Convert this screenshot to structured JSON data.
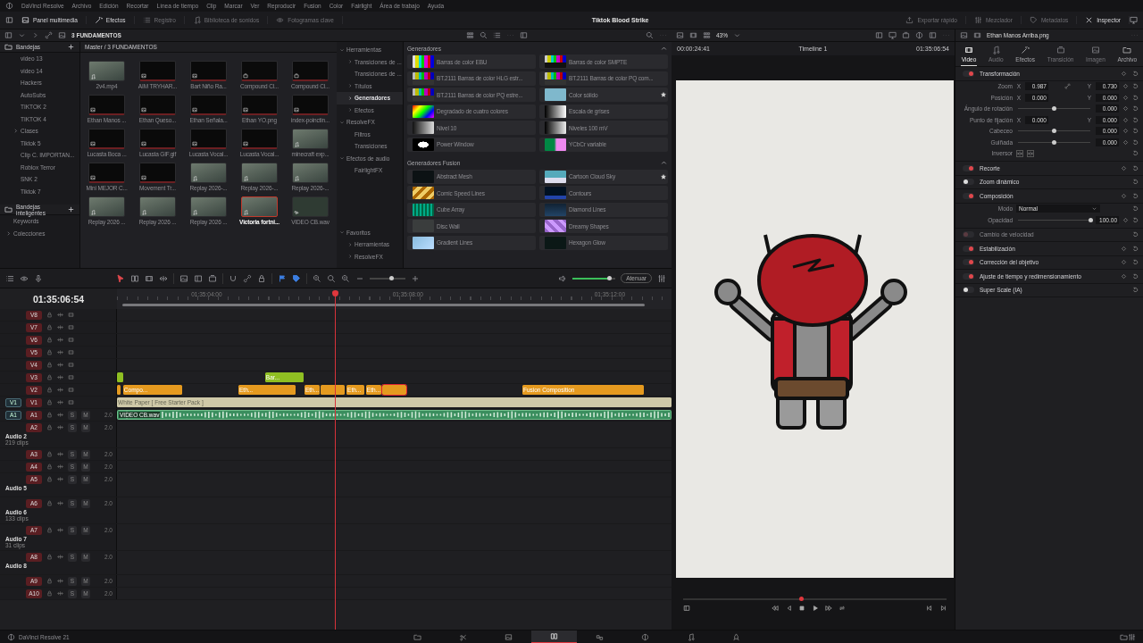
{
  "menu_bar": {
    "app": "DaVinci Resolve",
    "items": [
      "Archivo",
      "Edición",
      "Recortar",
      "Línea de tiempo",
      "Clip",
      "Marcar",
      "Ver",
      "Reproducir",
      "Fusion",
      "Color",
      "Fairlight",
      "Área de trabajo",
      "Ayuda"
    ]
  },
  "toolbar": {
    "left": [
      {
        "label": "Panel multimedia",
        "on": true
      },
      {
        "label": "Efectos",
        "on": true
      },
      {
        "label": "Registro",
        "on": false
      },
      {
        "label": "Biblioteca de sonidos",
        "on": false
      },
      {
        "label": "Fotogramas clave",
        "on": false
      }
    ],
    "project_title": "Tiktok Blood Strike",
    "right": [
      {
        "label": "Exportar rápido",
        "on": false
      },
      {
        "label": "Mezclador",
        "on": false
      },
      {
        "label": "Metadatos",
        "on": false
      },
      {
        "label": "Inspector",
        "on": true
      }
    ]
  },
  "media_pool": {
    "bin_name": "3 FUNDAMENTOS",
    "bins_title": "Bandejas",
    "bins": [
      {
        "label": "video 13",
        "expandable": false
      },
      {
        "label": "video 14",
        "expandable": false
      },
      {
        "label": "Hackers",
        "expandable": false
      },
      {
        "label": "AutoSubs",
        "expandable": false
      },
      {
        "label": "TIKTOK 2",
        "expandable": false
      },
      {
        "label": "TIKTOK 4",
        "expandable": false
      },
      {
        "label": "Clases",
        "expandable": true
      },
      {
        "label": "Tiktok 5",
        "expandable": false
      },
      {
        "label": "Clip C. IMPORTAN...",
        "expandable": false
      },
      {
        "label": "Roblox Terror",
        "expandable": false
      },
      {
        "label": "SNK 2",
        "expandable": false
      },
      {
        "label": "Tiktok 7",
        "expandable": false
      }
    ],
    "smart_bins_title": "Bandejas inteligentes",
    "smart_bins": [
      {
        "label": "Keywords",
        "expandable": false
      },
      {
        "label": "Colecciones",
        "expandable": true
      }
    ],
    "path": "Master / 3 FUNDAMENTOS",
    "clips": [
      {
        "name": "2v4.mp4",
        "kind": "video",
        "selected": false
      },
      {
        "name": "AIM TRYHAR...",
        "kind": "image",
        "selected": false
      },
      {
        "name": "Bart Niño Ra...",
        "kind": "image",
        "selected": false
      },
      {
        "name": "Compound Cl...",
        "kind": "compound",
        "selected": false
      },
      {
        "name": "Compound Cl...",
        "kind": "compound",
        "selected": false
      },
      {
        "name": "Ethan Manos ...",
        "kind": "image",
        "selected": false
      },
      {
        "name": "Ethan Queso...",
        "kind": "image",
        "selected": false
      },
      {
        "name": "Ethan Señala...",
        "kind": "image",
        "selected": false
      },
      {
        "name": "Ethan YO.png",
        "kind": "image",
        "selected": false
      },
      {
        "name": "index-poinctin...",
        "kind": "image",
        "selected": false
      },
      {
        "name": "Lucasta Boca ...",
        "kind": "image",
        "selected": false
      },
      {
        "name": "Lucasta GIF.gif",
        "kind": "image",
        "selected": false
      },
      {
        "name": "Lucasta Vocal...",
        "kind": "image",
        "selected": false
      },
      {
        "name": "Lucasta Vocal...",
        "kind": "image",
        "selected": false
      },
      {
        "name": "minecraft exp...",
        "kind": "video",
        "selected": false
      },
      {
        "name": "Mini MEJOR C...",
        "kind": "image",
        "selected": false
      },
      {
        "name": "Movement Tr...",
        "kind": "image",
        "selected": false
      },
      {
        "name": "Replay 2026-...",
        "kind": "video",
        "selected": false
      },
      {
        "name": "Replay 2026-...",
        "kind": "video",
        "selected": false
      },
      {
        "name": "Replay 2026-...",
        "kind": "video",
        "selected": false
      },
      {
        "name": "Replay 2026 ...",
        "kind": "video",
        "selected": false
      },
      {
        "name": "Replay 2026 ...",
        "kind": "video",
        "selected": false
      },
      {
        "name": "Replay 2026 ...",
        "kind": "video",
        "selected": false
      },
      {
        "name": "Victoria fortni...",
        "kind": "video",
        "selected": true
      },
      {
        "name": "VIDEO CB.wav",
        "kind": "audio",
        "selected": false
      }
    ]
  },
  "effects_library": {
    "tree": [
      {
        "label": "Herramientas",
        "expandable": true,
        "expanded": true,
        "selected": false,
        "children": [
          {
            "label": "Transiciones de ...",
            "expandable": true,
            "expanded": false,
            "selected": false
          },
          {
            "label": "Transiciones de ...",
            "expandable": false,
            "expanded": false,
            "selected": false
          },
          {
            "label": "Títulos",
            "expandable": true,
            "expanded": false,
            "selected": false
          },
          {
            "label": "Generadores",
            "expandable": true,
            "expanded": false,
            "selected": true
          },
          {
            "label": "Efectos",
            "expandable": true,
            "expanded": false,
            "selected": false
          }
        ]
      },
      {
        "label": "ResolveFX",
        "expandable": true,
        "expanded": true,
        "selected": false,
        "children": [
          {
            "label": "Filtros",
            "expandable": false,
            "expanded": false,
            "selected": false
          },
          {
            "label": "Transiciones",
            "expandable": false,
            "expanded": false,
            "selected": false
          }
        ]
      },
      {
        "label": "Efectos de audio",
        "expandable": true,
        "expanded": true,
        "selected": false,
        "children": [
          {
            "label": "FairlightFX",
            "expandable": false,
            "expanded": false,
            "selected": false
          }
        ]
      }
    ],
    "favorites": {
      "label": "Favoritos",
      "children": [
        {
          "label": "Herramientas",
          "expandable": true,
          "expanded": false,
          "selected": false
        },
        {
          "label": "ResolveFX",
          "expandable": true,
          "expanded": false,
          "selected": false
        }
      ]
    },
    "sections": [
      {
        "title": "Generadores",
        "items": [
          {
            "name": "Barras de color EBU",
            "favorite": false
          },
          {
            "name": "Barras de color SMPTE",
            "favorite": false
          },
          {
            "name": "BT.2111 Barras de color HLG estr...",
            "favorite": false
          },
          {
            "name": "BT.2111 Barras de color PQ com...",
            "favorite": false
          },
          {
            "name": "BT.2111 Barras de color PQ estre...",
            "favorite": false
          },
          {
            "name": "Color sólido",
            "favorite": true
          },
          {
            "name": "Degradado de cuatro colores",
            "favorite": false
          },
          {
            "name": "Escala de grises",
            "favorite": false
          },
          {
            "name": "Nivel 10",
            "favorite": false
          },
          {
            "name": "Niveles 100 mV",
            "favorite": false
          },
          {
            "name": "Power Window",
            "favorite": false
          },
          {
            "name": "YCbCr variable",
            "favorite": false
          }
        ]
      },
      {
        "title": "Generadores Fusion",
        "items": [
          {
            "name": "Abstract Mesh",
            "favorite": false
          },
          {
            "name": "Cartoon Cloud Sky",
            "favorite": true
          },
          {
            "name": "Comic Speed Lines",
            "favorite": false
          },
          {
            "name": "Contours",
            "favorite": false
          },
          {
            "name": "Cube Array",
            "favorite": false
          },
          {
            "name": "Diamond Lines",
            "favorite": false
          },
          {
            "name": "Disc Wall",
            "favorite": false
          },
          {
            "name": "Dreamy Shapes",
            "favorite": false
          },
          {
            "name": "Gradient Lines",
            "favorite": false
          },
          {
            "name": "Hexagon Glow",
            "favorite": false
          }
        ]
      }
    ]
  },
  "viewer": {
    "zoom": "43%",
    "source_timecode": "00:00:24:41",
    "timeline_name": "Timeline 1",
    "record_timecode": "01:35:06:54"
  },
  "inspector": {
    "clip_name": "Ethan Manos Arriba.png",
    "tabs": [
      {
        "label": "Video",
        "selected": true,
        "disabled": false
      },
      {
        "label": "Audio",
        "selected": false,
        "disabled": true
      },
      {
        "label": "Efectos",
        "selected": false,
        "disabled": false
      },
      {
        "label": "Transición",
        "selected": false,
        "disabled": true
      },
      {
        "label": "Imagen",
        "selected": false,
        "disabled": true
      },
      {
        "label": "Archivo",
        "selected": false,
        "disabled": false
      }
    ],
    "sections": [
      {
        "title": "Transformación",
        "on": true,
        "disabled": false,
        "params": [
          {
            "kind": "xy",
            "label": "Zoom",
            "linked": true,
            "x": {
              "axis": "X",
              "value": "0.987"
            },
            "y": {
              "axis": "Y",
              "value": "0.730"
            }
          },
          {
            "kind": "xy",
            "label": "Posición",
            "linked": false,
            "x": {
              "axis": "X",
              "value": "0.000"
            },
            "y": {
              "axis": "Y",
              "value": "0.000"
            }
          },
          {
            "kind": "slider",
            "label": "Ángulo de rotación",
            "level": 0.5,
            "value": "0.000"
          },
          {
            "kind": "xy",
            "label": "Punto de fijación",
            "linked": false,
            "x": {
              "axis": "X",
              "value": "0.000"
            },
            "y": {
              "axis": "Y",
              "value": "0.000"
            }
          },
          {
            "kind": "slider",
            "label": "Cabeceo",
            "level": 0.5,
            "value": "0.000"
          },
          {
            "kind": "slider",
            "label": "Guiñada",
            "level": 0.5,
            "value": "0.000"
          },
          {
            "kind": "flip",
            "label": "Inversor"
          }
        ]
      },
      {
        "title": "Recorte",
        "on": true,
        "disabled": false
      },
      {
        "title": "Zoom dinámico",
        "on": false,
        "disabled": false
      },
      {
        "title": "Composición",
        "on": true,
        "disabled": false,
        "params": [
          {
            "kind": "select",
            "label": "Modo",
            "value": "Normal"
          },
          {
            "kind": "slider",
            "label": "Opacidad",
            "level": 1.0,
            "value": "100.00"
          }
        ]
      },
      {
        "title": "Cambio de velocidad",
        "on": false,
        "disabled": true
      },
      {
        "title": "Estabilización",
        "on": true,
        "disabled": false
      },
      {
        "title": "Corrección del objetivo",
        "on": true,
        "disabled": false
      },
      {
        "title": "Ajuste de tiempo y redimensionamiento",
        "on": true,
        "disabled": false
      },
      {
        "title": "Super Scale (IA)",
        "on": false,
        "disabled": false
      }
    ]
  },
  "timeline": {
    "timecode": "01:35:06:54",
    "zoom_slider": {
      "level": 0.6
    },
    "volume": {
      "level": 0.85
    },
    "dim_button": "Atenuar",
    "ruler": [
      "01:35:04:00",
      "01:35:08:00",
      "01:35:12:00"
    ],
    "tracks": [
      {
        "label": "V8",
        "kind": "video"
      },
      {
        "label": "V7",
        "kind": "video"
      },
      {
        "label": "V6",
        "kind": "video"
      },
      {
        "label": "V5",
        "kind": "video"
      },
      {
        "label": "V4",
        "kind": "video"
      },
      {
        "label": "V3",
        "kind": "video",
        "clips": [
          {
            "kind": "title",
            "selected": false
          },
          {
            "kind": "title",
            "name": "Bar...",
            "selected": false
          }
        ]
      },
      {
        "label": "V2",
        "kind": "video",
        "clips": [
          {
            "kind": "video",
            "selected": false
          },
          {
            "kind": "video",
            "name": "Compo...",
            "selected": false
          },
          {
            "kind": "video",
            "name": "Eth...",
            "selected": false
          },
          {
            "kind": "video",
            "name": "Eth...",
            "selected": false
          },
          {
            "kind": "video",
            "selected": false
          },
          {
            "kind": "video",
            "name": "Eth...",
            "selected": false
          },
          {
            "kind": "video",
            "name": "Eth...",
            "selected": false
          },
          {
            "kind": "video",
            "selected": true
          },
          {
            "kind": "video",
            "name": "Fusion Composition",
            "selected": false
          }
        ]
      },
      {
        "label": "V1",
        "kind": "video",
        "patch": "V1",
        "clips": [
          {
            "kind": "background",
            "name": "White Paper [ Free Starter Pack ]",
            "selected": false
          }
        ]
      },
      {
        "label": "A1",
        "kind": "audio",
        "patch": "A1",
        "solo": "S",
        "mute": "M",
        "channels": "2.0",
        "clips": [
          {
            "kind": "audio",
            "name": "VIDEO CB.wav",
            "selected": false
          }
        ]
      },
      {
        "label": "A2",
        "kind": "audio",
        "solo": "S",
        "mute": "M",
        "channels": "2.0",
        "name": "Audio 2",
        "clip_count": "219 clips"
      },
      {
        "label": "A3",
        "kind": "audio",
        "solo": "S",
        "mute": "M",
        "channels": "2.0"
      },
      {
        "label": "A4",
        "kind": "audio",
        "solo": "S",
        "mute": "M",
        "channels": "2.0"
      },
      {
        "label": "A5",
        "kind": "audio",
        "solo": "S",
        "mute": "M",
        "channels": "2.0",
        "name": "Audio 5"
      },
      {
        "label": "A6",
        "kind": "audio",
        "solo": "S",
        "mute": "M",
        "channels": "2.0",
        "name": "Audio 6",
        "clip_count": "133 clips"
      },
      {
        "label": "A7",
        "kind": "audio",
        "solo": "S",
        "mute": "M",
        "channels": "2.0",
        "name": "Audio 7",
        "clip_count": "31 clips"
      },
      {
        "label": "A8",
        "kind": "audio",
        "solo": "S",
        "mute": "M",
        "channels": "2.0",
        "name": "Audio 8"
      },
      {
        "label": "A9",
        "kind": "audio",
        "solo": "S",
        "mute": "M",
        "channels": "2.0"
      },
      {
        "label": "A10",
        "kind": "audio",
        "solo": "S",
        "mute": "M",
        "channels": "2.0"
      }
    ]
  },
  "page_bar": {
    "app_version": "DaVinci Resolve 21",
    "pages": [
      {
        "kind": "media",
        "selected": false
      },
      {
        "kind": "cut",
        "selected": false
      },
      {
        "kind": "photo",
        "selected": false
      },
      {
        "kind": "edit",
        "selected": true
      },
      {
        "kind": "fusion",
        "selected": false
      },
      {
        "kind": "color",
        "selected": false
      },
      {
        "kind": "fairlight",
        "selected": false
      },
      {
        "kind": "deliver",
        "selected": false
      }
    ]
  }
}
